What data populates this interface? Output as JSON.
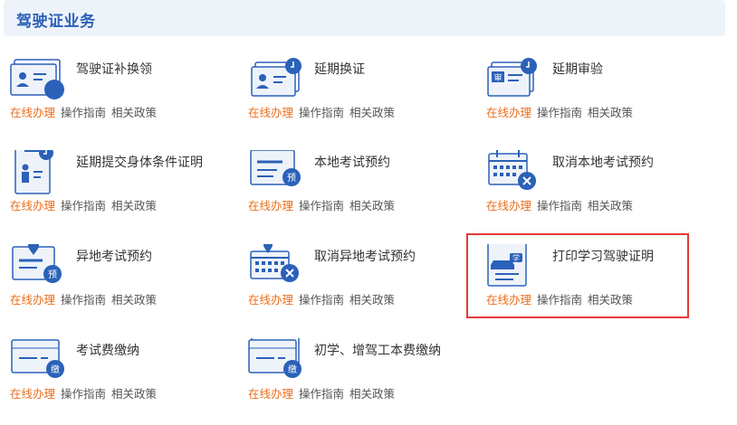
{
  "section": {
    "title": "驾驶证业务"
  },
  "link_labels": {
    "online": "在线办理",
    "guide": "操作指南",
    "policy": "相关政策"
  },
  "colors": {
    "accent": "#2b61b8",
    "online": "#ea6d1a",
    "highlight": "#e53935"
  },
  "items": [
    {
      "name": "驾驶证补换领",
      "icon": "license-card-icon"
    },
    {
      "name": "延期换证",
      "icon": "license-extend-icon"
    },
    {
      "name": "延期审验",
      "icon": "review-extend-icon"
    },
    {
      "name": "延期提交身体条件证明",
      "icon": "health-certificate-icon"
    },
    {
      "name": "本地考试预约",
      "icon": "local-exam-booking-icon",
      "badge": "预"
    },
    {
      "name": "取消本地考试预约",
      "icon": "cancel-local-exam-icon"
    },
    {
      "name": "异地考试预约",
      "icon": "remote-exam-booking-icon",
      "badge": "预"
    },
    {
      "name": "取消异地考试预约",
      "icon": "cancel-remote-exam-icon"
    },
    {
      "name": "打印学习驾驶证明",
      "icon": "print-learner-permit-icon",
      "badge": "学",
      "highlighted": true
    },
    {
      "name": "考试费缴纳",
      "icon": "exam-fee-payment-icon",
      "badge": "缴"
    },
    {
      "name": "初学、增驾工本费缴纳",
      "icon": "license-fee-payment-icon",
      "badge": "缴"
    }
  ],
  "review_badge": "审"
}
